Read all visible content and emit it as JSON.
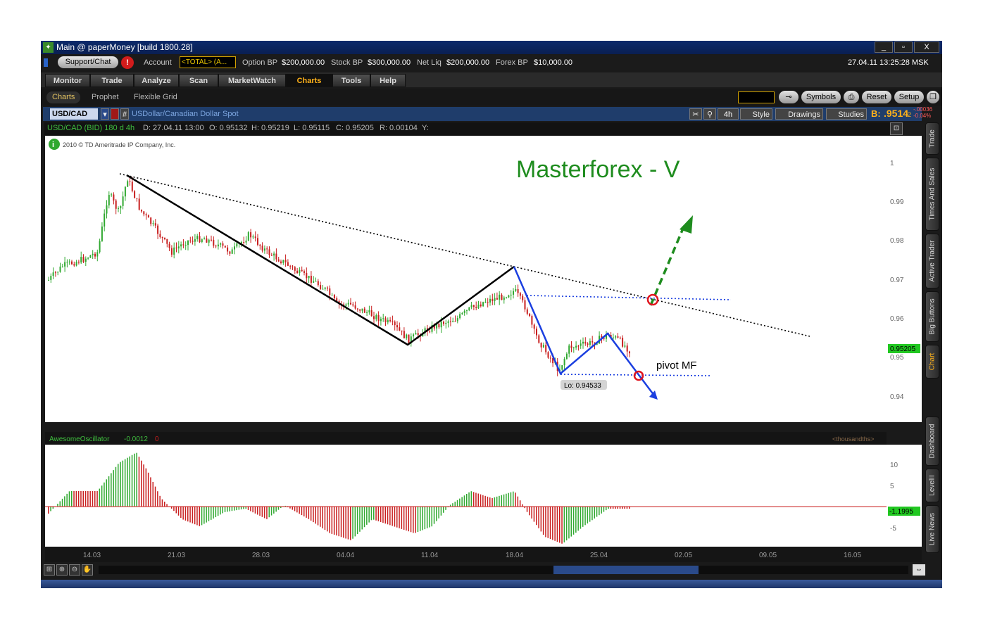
{
  "window": {
    "title": "Main @ paperMoney [build 1800.28]",
    "minimize": "_",
    "restore": "▫",
    "close": "X"
  },
  "infobar": {
    "support": "Support/Chat",
    "alert": "!",
    "account_label": "Account",
    "account_value": "<TOTAL> (A...",
    "option_bp_label": "Option BP",
    "option_bp": "$200,000.00",
    "stock_bp_label": "Stock BP",
    "stock_bp": "$300,000.00",
    "net_liq_label": "Net Liq",
    "net_liq": "$200,000.00",
    "forex_bp_label": "Forex BP",
    "forex_bp": "$10,000.00",
    "datetime": "27.04.11 13:25:28 MSK"
  },
  "tabs": [
    "Monitor",
    "Trade",
    "Analyze",
    "Scan",
    "MarketWatch",
    "Charts",
    "Tools",
    "Help"
  ],
  "subtabs": [
    "Charts",
    "Prophet",
    "Flexible Grid"
  ],
  "toolbar_right": {
    "symbols": "Symbols",
    "reset": "Reset",
    "setup": "Setup"
  },
  "chart_header": {
    "symbol": "USD/CAD",
    "description": "USDollar/Canadian Dollar Spot",
    "timeframe": "4h",
    "style": "Style",
    "drawings": "Drawings",
    "studies": "Studies",
    "bid_label": "B:",
    "bid_value": ".9514",
    "bid_sub": "2",
    "change_abs": "-.00036",
    "change_pct": "-0.04%"
  },
  "ohlc": {
    "sym": "USD/CAD (BID) 180 d 4h",
    "date": "D: 27.04.11 13:00",
    "open": "O: 0.95132",
    "high": "H: 0.95219",
    "low": "L: 0.95115",
    "close": "C: 0.95205",
    "range": "R: 0.00104",
    "y": "Y:"
  },
  "copyright": "2010 © TD Ameritrade IP Company, Inc.",
  "annotations": {
    "title": "Masterforex - V",
    "pivot": "pivot MF",
    "low_label": "Lo: 0.94533",
    "last_price": "0.95205"
  },
  "price_axis": [
    "1",
    "0.99",
    "0.98",
    "0.97",
    "0.96",
    "0.95",
    "0.94"
  ],
  "oscillator": {
    "name": "AwesomeOscillator",
    "value": "-0.0012",
    "zero": "0",
    "units": "<thousandths>",
    "axis": [
      "10",
      "5",
      "-5"
    ],
    "current": "-1.1995"
  },
  "date_axis": [
    "14.03",
    "21.03",
    "28.03",
    "04.04",
    "11.04",
    "18.04",
    "25.04",
    "02.05",
    "09.05",
    "16.05"
  ],
  "sidebar_tabs": [
    "Trade",
    "Times And Sales",
    "Active Trader",
    "Big Buttons",
    "Chart",
    "Dashboard",
    "LevelII",
    "Live News"
  ],
  "colors": {
    "bull": "#2fa82f",
    "bear": "#c81e1e",
    "annotation_green": "#1e8c1e",
    "annotation_blue": "#1b3fe0",
    "accent_orange": "#ffb21a"
  }
}
